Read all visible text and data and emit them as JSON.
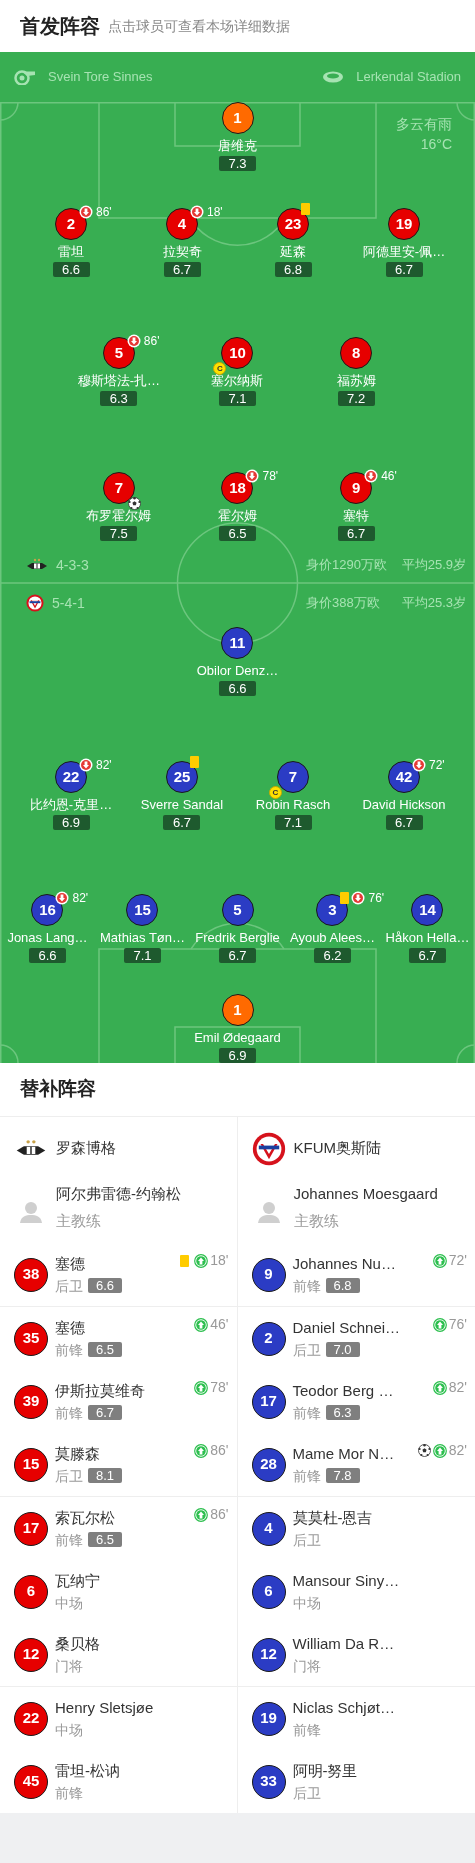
{
  "header": {
    "title": "首发阵容",
    "subtitle": "点击球员可查看本场详细数据"
  },
  "match_info": {
    "referee": "Svein Tore Sinnes",
    "stadium": "Lerkendal Stadion",
    "weather": "多云有雨",
    "temperature": "16°C"
  },
  "home": {
    "formation": "4-3-3",
    "value": "身价1290万欧",
    "average_age": "平均25.9岁",
    "lines": [
      {
        "players": [
          {
            "number": "1",
            "name": "唐维克",
            "rating": "7.3",
            "color": "#ff6a00"
          }
        ]
      },
      {
        "players": [
          {
            "number": "2",
            "name": "雷坦",
            "rating": "6.6",
            "color": "#e60000",
            "events": [
              {
                "kind": "sub_off",
                "minute": "86'"
              }
            ]
          },
          {
            "number": "4",
            "name": "拉契奇",
            "rating": "6.7",
            "color": "#e60000",
            "events": [
              {
                "kind": "sub_off",
                "minute": "18'"
              }
            ]
          },
          {
            "number": "23",
            "name": "延森",
            "rating": "6.8",
            "color": "#e60000",
            "events": [
              {
                "kind": "yellow_card"
              }
            ]
          },
          {
            "number": "19",
            "name": "阿德里安-佩…",
            "rating": "6.7",
            "color": "#e60000"
          }
        ]
      },
      {
        "players": [
          {
            "number": "5",
            "name": "穆斯塔法-扎…",
            "rating": "6.3",
            "color": "#e60000",
            "events": [
              {
                "kind": "sub_off",
                "minute": "86'"
              }
            ]
          },
          {
            "number": "10",
            "name": "塞尔纳斯",
            "rating": "7.1",
            "color": "#e60000",
            "events": [
              {
                "kind": "captain",
                "label": "C"
              }
            ]
          },
          {
            "number": "8",
            "name": "福苏姆",
            "rating": "7.2",
            "color": "#e60000"
          }
        ]
      },
      {
        "players": [
          {
            "number": "7",
            "name": "布罗霍尔姆",
            "rating": "7.5",
            "color": "#e60000",
            "events": [
              {
                "kind": "goal"
              }
            ]
          },
          {
            "number": "18",
            "name": "霍尔姆",
            "rating": "6.5",
            "color": "#e60000",
            "events": [
              {
                "kind": "sub_off",
                "minute": "78'"
              }
            ]
          },
          {
            "number": "9",
            "name": "塞特",
            "rating": "6.7",
            "color": "#e60000",
            "events": [
              {
                "kind": "sub_off",
                "minute": "46'"
              }
            ]
          }
        ]
      }
    ]
  },
  "away": {
    "formation": "5-4-1",
    "value": "身价388万欧",
    "average_age": "平均25.3岁",
    "lines": [
      {
        "players": [
          {
            "number": "11",
            "name": "Obilor Denz…",
            "rating": "6.6",
            "color": "#2b3cc4"
          }
        ]
      },
      {
        "players": [
          {
            "number": "22",
            "name": "比约恩-克里…",
            "rating": "6.9",
            "color": "#2b3cc4",
            "events": [
              {
                "kind": "sub_off",
                "minute": "82'"
              }
            ]
          },
          {
            "number": "25",
            "name": "Sverre Sandal",
            "rating": "6.7",
            "color": "#2b3cc4",
            "events": [
              {
                "kind": "yellow_card"
              }
            ]
          },
          {
            "number": "7",
            "name": "Robin Rasch",
            "rating": "7.1",
            "color": "#2b3cc4",
            "events": [
              {
                "kind": "captain",
                "label": "C"
              }
            ]
          },
          {
            "number": "42",
            "name": "David Hickson",
            "rating": "6.7",
            "color": "#2b3cc4",
            "events": [
              {
                "kind": "sub_off",
                "minute": "72'"
              }
            ]
          }
        ]
      },
      {
        "players": [
          {
            "number": "16",
            "name": "Jonas Lang…",
            "rating": "6.6",
            "color": "#2b3cc4",
            "events": [
              {
                "kind": "sub_off",
                "minute": "82'"
              }
            ]
          },
          {
            "number": "15",
            "name": "Mathias Tøn…",
            "rating": "7.1",
            "color": "#2b3cc4"
          },
          {
            "number": "5",
            "name": "Fredrik Berglie",
            "rating": "6.7",
            "color": "#2b3cc4"
          },
          {
            "number": "3",
            "name": "Ayoub Alees…",
            "rating": "6.2",
            "color": "#2b3cc4",
            "events": [
              {
                "kind": "yellow_card"
              },
              {
                "kind": "sub_off",
                "minute": "76'"
              }
            ]
          },
          {
            "number": "14",
            "name": "Håkon Hella…",
            "rating": "6.7",
            "color": "#2b3cc4"
          }
        ]
      },
      {
        "players": [
          {
            "number": "1",
            "name": "Emil Ødegaard",
            "rating": "6.9",
            "color": "#ff6a00"
          }
        ]
      }
    ]
  },
  "bench": {
    "title": "替补阵容",
    "teams": [
      {
        "name": "罗森博格",
        "color": "#e60000",
        "coach": {
          "name": "阿尔弗雷德-约翰松",
          "role": "主教练"
        },
        "subs": [
          {
            "number": "38",
            "name": "塞德",
            "position": "后卫",
            "rating": "6.6",
            "events": [
              {
                "kind": "yellow_card"
              },
              {
                "kind": "sub_on",
                "minute": "18'"
              }
            ]
          },
          {
            "number": "35",
            "name": "塞德",
            "position": "前锋",
            "rating": "6.5",
            "events": [
              {
                "kind": "sub_on",
                "minute": "46'"
              }
            ]
          },
          {
            "number": "39",
            "name": "伊斯拉莫维奇",
            "position": "前锋",
            "rating": "6.7",
            "events": [
              {
                "kind": "sub_on",
                "minute": "78'"
              }
            ]
          },
          {
            "number": "15",
            "name": "莫滕森",
            "position": "后卫",
            "rating": "8.1",
            "events": [
              {
                "kind": "sub_on",
                "minute": "86'"
              }
            ]
          },
          {
            "number": "17",
            "name": "索瓦尔松",
            "position": "前锋",
            "rating": "6.5",
            "events": [
              {
                "kind": "sub_on",
                "minute": "86'"
              }
            ]
          },
          {
            "number": "6",
            "name": "瓦纳宁",
            "position": "中场"
          },
          {
            "number": "12",
            "name": "桑贝格",
            "position": "门将"
          },
          {
            "number": "22",
            "name": "Henry Sletsjøe",
            "position": "中场"
          },
          {
            "number": "45",
            "name": "雷坦-松讷",
            "position": "前锋"
          }
        ]
      },
      {
        "name": "KFUM奥斯陆",
        "color": "#2b3cc4",
        "coach": {
          "name": "Johannes Moesgaard",
          "role": "主教练"
        },
        "subs": [
          {
            "number": "9",
            "name": "Johannes Nu…",
            "position": "前锋",
            "rating": "6.8",
            "events": [
              {
                "kind": "sub_on",
                "minute": "72'"
              }
            ]
          },
          {
            "number": "2",
            "name": "Daniel Schnei…",
            "position": "后卫",
            "rating": "7.0",
            "events": [
              {
                "kind": "sub_on",
                "minute": "76'"
              }
            ]
          },
          {
            "number": "17",
            "name": "Teodor Berg …",
            "position": "前锋",
            "rating": "6.3",
            "events": [
              {
                "kind": "sub_on",
                "minute": "82'"
              }
            ]
          },
          {
            "number": "28",
            "name": "Mame Mor N…",
            "position": "前锋",
            "rating": "7.8",
            "events": [
              {
                "kind": "goal"
              },
              {
                "kind": "sub_on",
                "minute": "82'"
              }
            ]
          },
          {
            "number": "4",
            "name": "莫莫杜-恩吉",
            "position": "后卫"
          },
          {
            "number": "6",
            "name": "Mansour Siny…",
            "position": "中场"
          },
          {
            "number": "12",
            "name": "William Da R…",
            "position": "门将"
          },
          {
            "number": "19",
            "name": "Niclas Schjøt…",
            "position": "前锋"
          },
          {
            "number": "33",
            "name": "阿明-努里",
            "position": "后卫"
          }
        ]
      }
    ]
  }
}
